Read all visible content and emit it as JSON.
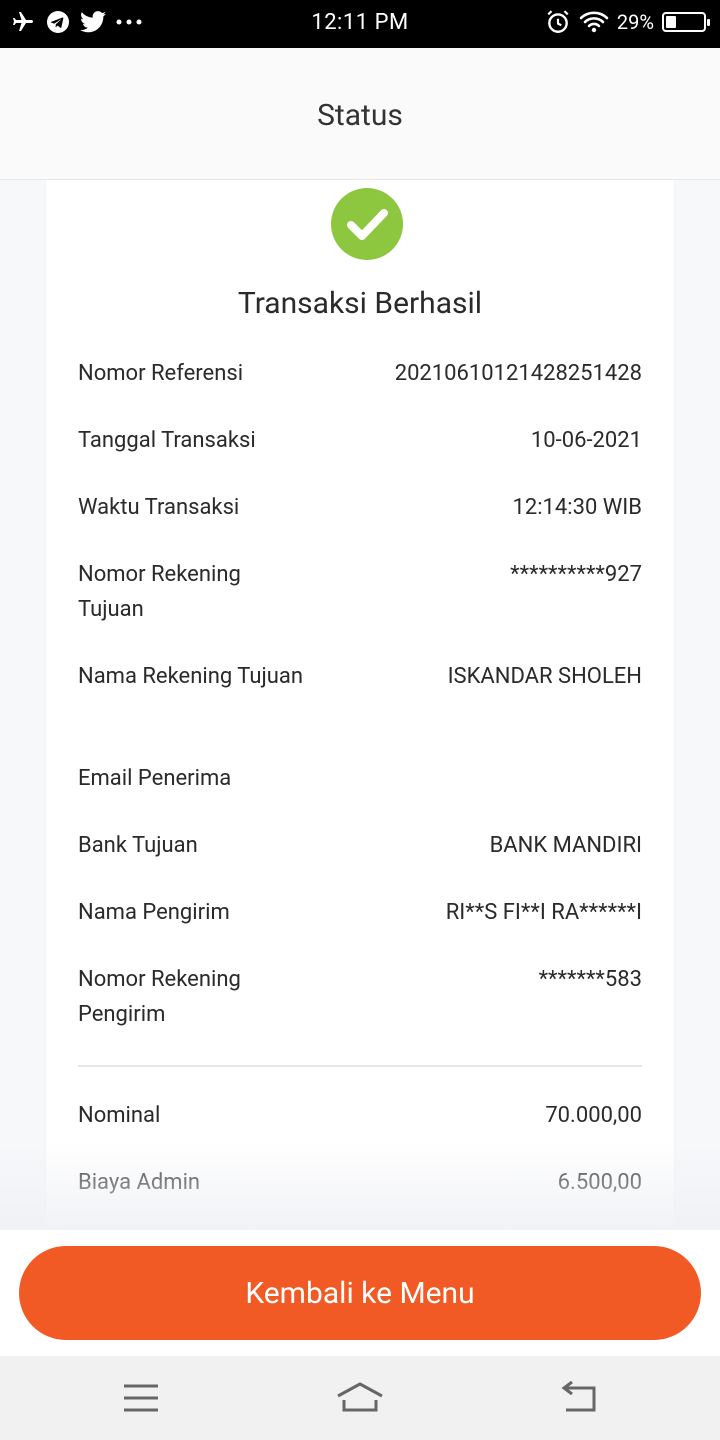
{
  "status_bar": {
    "time": "12:11 PM",
    "battery": "29%",
    "left_icons": [
      "airplane-icon",
      "telegram-icon",
      "twitter-icon",
      "more-icon"
    ],
    "right_icons": [
      "alarm-icon",
      "wifi-icon",
      "battery-icon"
    ]
  },
  "header": {
    "title": "Status"
  },
  "result": {
    "title": "Transaksi Berhasil",
    "icon": "check-circle-icon",
    "icon_color": "#8dc63f"
  },
  "details": [
    {
      "label": "Nomor Referensi",
      "value": "2021061012142825142 8"
    },
    {
      "label": "Tanggal Transaksi",
      "value": "10-06-2021"
    },
    {
      "label": "Waktu Transaksi",
      "value": "12:14:30 WIB"
    },
    {
      "label": "Nomor Rekening Tujuan",
      "value": "**********927"
    },
    {
      "label": "Nama Rekening Tujuan",
      "value": "ISKANDAR SHOLEH"
    },
    {
      "label": "Email Penerima",
      "value": ""
    },
    {
      "label": "Bank Tujuan",
      "value": "BANK MANDIRI"
    },
    {
      "label": "Nama Pengirim",
      "value": "RI**S FI**I RA******I"
    },
    {
      "label": "Nomor Rekening Pengirim",
      "value": "*******583"
    }
  ],
  "amounts": [
    {
      "label": "Nominal",
      "value": "70.000,00"
    },
    {
      "label": "Biaya Admin",
      "value": "6.500,00"
    }
  ],
  "button": {
    "label": "Kembali ke Menu",
    "color": "#f15a24"
  },
  "nav_bar": {
    "icons": [
      "menu-icon",
      "home-icon",
      "back-icon"
    ]
  }
}
